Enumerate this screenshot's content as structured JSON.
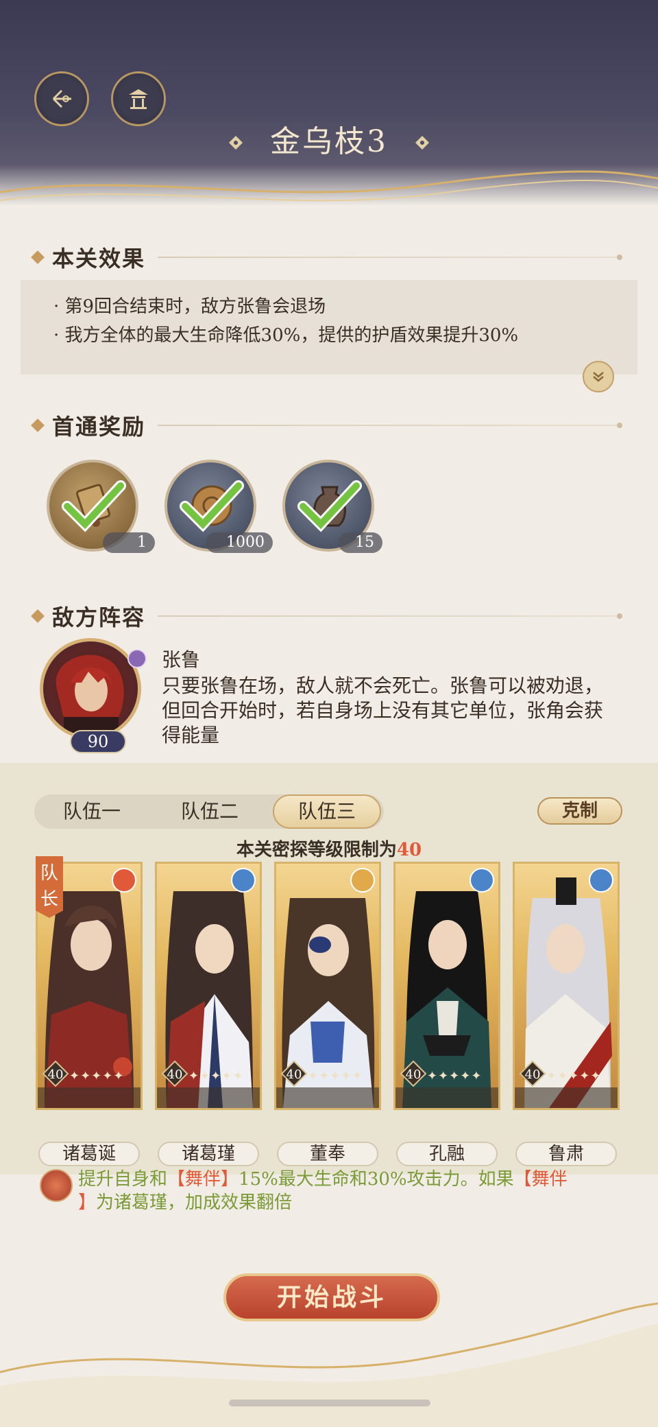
{
  "header": {
    "title": "金乌枝3"
  },
  "effects": {
    "heading": "本关效果",
    "lines": [
      "· 第9回合结束时，敌方张鲁会退场",
      "· 我方全体的最大生命降低30%，提供的护盾效果提升30%"
    ]
  },
  "rewards": {
    "heading": "首通奖励",
    "items": [
      {
        "name": "token-icon",
        "count": "1",
        "claimed": true
      },
      {
        "name": "coin-icon",
        "count": "1000",
        "claimed": true
      },
      {
        "name": "jar-icon",
        "count": "15",
        "claimed": true
      }
    ]
  },
  "enemy": {
    "heading": "敌方阵容",
    "name": "张鲁",
    "level": "90",
    "description": "只要张鲁在场，敌人就不会死亡。张鲁可以被劝退，但回合开始时，若自身场上没有其它单位，张角会获得能量"
  },
  "team": {
    "tabs": [
      "队伍一",
      "队伍二",
      "队伍三"
    ],
    "active_tab": 2,
    "counter_label": "克制",
    "limit_prefix": "本关密探等级限制为",
    "limit_value": "40",
    "captain_label": "队长",
    "members": [
      {
        "name": "诸葛诞",
        "level": "40",
        "element": "fire-icon",
        "color": "#e05a3a"
      },
      {
        "name": "诸葛瑾",
        "level": "40",
        "element": "water-swirl-icon",
        "color": "#4b84c8"
      },
      {
        "name": "董奉",
        "level": "40",
        "element": "moon-icon",
        "color": "#e1a94a"
      },
      {
        "name": "孔融",
        "level": "40",
        "element": "water-swirl-icon",
        "color": "#4b84c8"
      },
      {
        "name": "鲁肃",
        "level": "40",
        "element": "water-swirl-icon",
        "color": "#4b84c8"
      }
    ]
  },
  "skill": {
    "part1": "提升自身和",
    "hl1": "【舞伴】",
    "part2": "15%最大生命和30%攻击力。如果",
    "hl2": "【舞伴",
    "hl3": "】",
    "part3": "为诸葛瑾，加成效果翻倍"
  },
  "start_button": "开始战斗",
  "colors": {
    "accent": "#b8432e",
    "gold": "#d8b36a",
    "highlight": "#e05a3a",
    "skill_text": "#7a9a35"
  }
}
